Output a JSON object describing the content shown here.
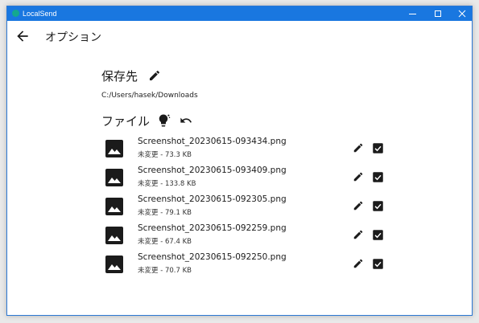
{
  "window": {
    "title": "LocalSend"
  },
  "header": {
    "title": "オプション",
    "back_icon": "arrow-back-icon"
  },
  "destination": {
    "title": "保存先",
    "path": "C:/Users/hasek/Downloads",
    "edit_icon": "pencil-icon"
  },
  "files_section": {
    "title": "ファイル",
    "icons": [
      "lightbulb-icon",
      "undo-icon"
    ]
  },
  "files": [
    {
      "name": "Screenshot_20230615-093434.png",
      "meta": "未変更 - 73.3 KB",
      "checked": true
    },
    {
      "name": "Screenshot_20230615-093409.png",
      "meta": "未変更 - 133.8 KB",
      "checked": true
    },
    {
      "name": "Screenshot_20230615-092305.png",
      "meta": "未変更 - 79.1 KB",
      "checked": true
    },
    {
      "name": "Screenshot_20230615-092259.png",
      "meta": "未変更 - 67.4 KB",
      "checked": true
    },
    {
      "name": "Screenshot_20230615-092250.png",
      "meta": "未変更 - 70.7 KB",
      "checked": true
    }
  ],
  "colors": {
    "titlebar": "#1977e0",
    "text": "#1b1b1b"
  }
}
